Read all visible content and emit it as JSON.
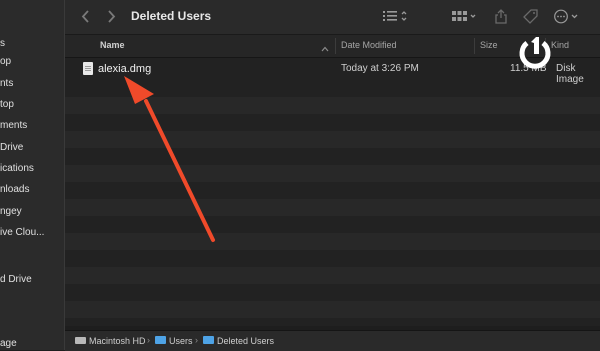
{
  "sidebar": {
    "items": [
      {
        "label": "s"
      },
      {
        "label": "op"
      },
      {
        "label": "nts"
      },
      {
        "label": "top"
      },
      {
        "label": "ments"
      },
      {
        "label": "Drive"
      },
      {
        "label": "ications"
      },
      {
        "label": "nloads"
      },
      {
        "label": "ngey"
      },
      {
        "label": "ive Clou..."
      },
      {
        "label": "d Drive"
      },
      {
        "label": "age"
      }
    ]
  },
  "toolbar": {
    "title": "Deleted Users",
    "back_icon": "chevron-left-icon",
    "forward_icon": "chevron-right-icon",
    "list_view_icon": "list-view-icon",
    "grid_view_icon": "grid-view-icon",
    "share_icon": "share-icon",
    "tag_icon": "tag-icon",
    "more_icon": "ellipsis-circle-icon"
  },
  "columns": {
    "name": "Name",
    "date_modified": "Date Modified",
    "size": "Size",
    "kind": "Kind"
  },
  "files": [
    {
      "name": "alexia.dmg",
      "date_modified": "Today at 3:26 PM",
      "size": "11.5 MB",
      "kind": "Disk Image"
    }
  ],
  "path": {
    "segments": [
      "Macintosh HD",
      "Users",
      "Deleted Users"
    ]
  },
  "annotation": {
    "arrow_color": "#f04a2a"
  },
  "watermark_text": "1"
}
